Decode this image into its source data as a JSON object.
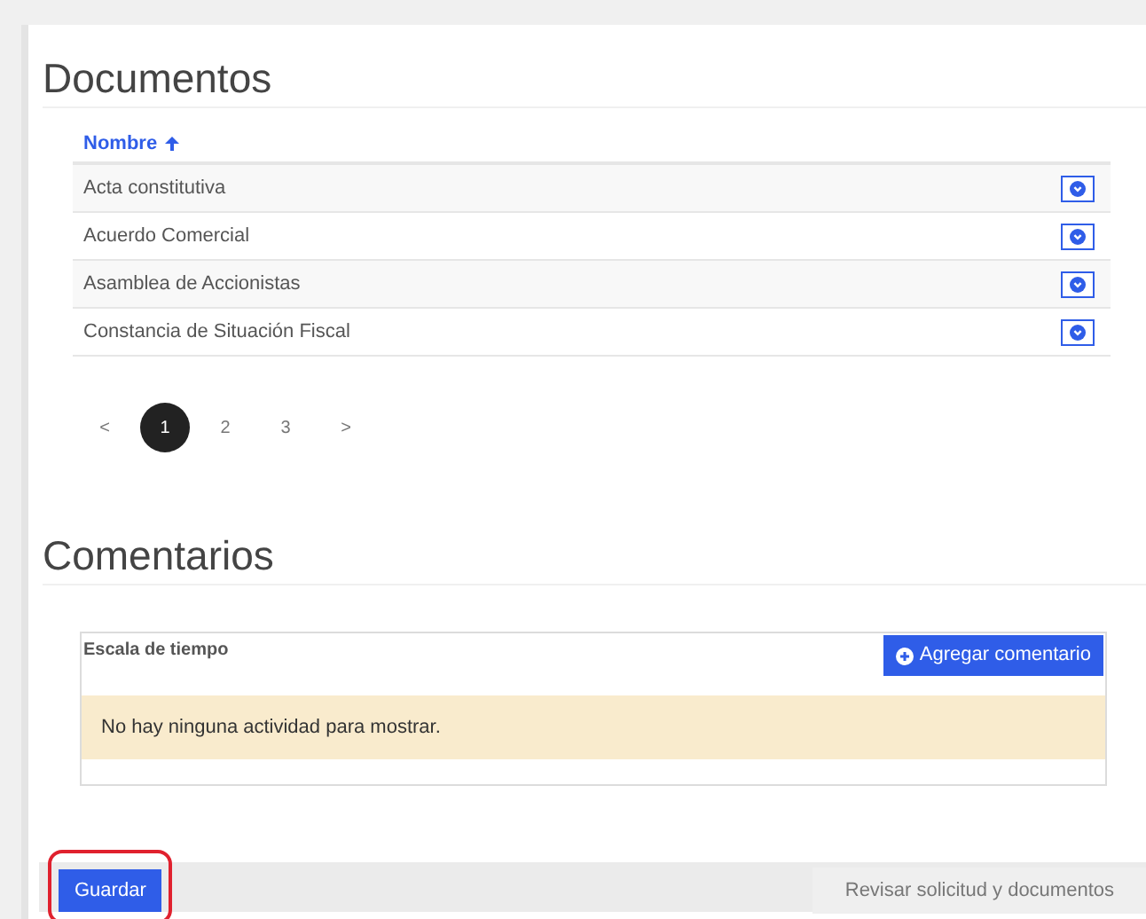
{
  "documents": {
    "title": "Documentos",
    "column": {
      "label": "Nombre",
      "ascending": true
    },
    "rows": [
      {
        "name": "Acta constitutiva"
      },
      {
        "name": "Acuerdo Comercial"
      },
      {
        "name": "Asamblea de Accionistas"
      },
      {
        "name": "Constancia de Situación Fiscal"
      }
    ],
    "pagination": [
      {
        "label": "<",
        "selected": false
      },
      {
        "label": "1",
        "selected": true
      },
      {
        "label": "2",
        "selected": false
      },
      {
        "label": "3",
        "selected": false
      },
      {
        "label": ">",
        "selected": false
      }
    ]
  },
  "comments": {
    "title": "Comentarios",
    "timeline_label": "Escala de tiempo",
    "add_button": "Agregar comentario",
    "empty_message": "No hay ninguna actividad para mostrar."
  },
  "footer": {
    "save_button": "Guardar",
    "save_highlighted": true,
    "review_button": "Revisar solicitud y documentos"
  }
}
